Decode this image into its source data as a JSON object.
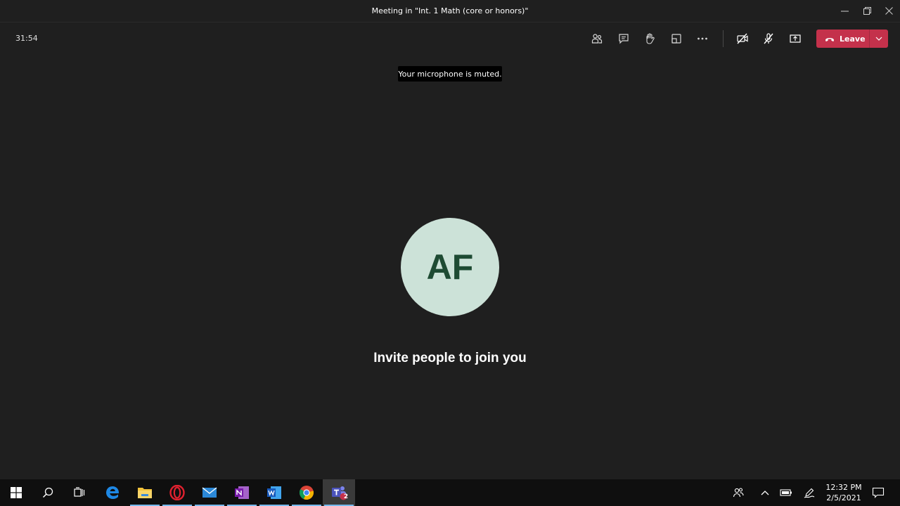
{
  "window": {
    "title": "Meeting in \"Int. 1 Math (core or honors)\"",
    "controls": [
      "minimize-icon",
      "restore-icon",
      "close-icon"
    ]
  },
  "meeting": {
    "timer": "31:54",
    "toolbar": [
      "participants-icon",
      "chat-icon",
      "raise-hand-icon",
      "breakout-rooms-icon",
      "more-options-icon",
      "camera-off-icon",
      "mic-off-icon",
      "share-screen-icon"
    ],
    "leave_label": "Leave",
    "accent": "#c4314b"
  },
  "toast": {
    "text": "Your microphone is muted."
  },
  "stage": {
    "avatar_initials": "AF",
    "avatar_bg": "#cce2d8",
    "avatar_fg": "#1e4b33",
    "invite_text": "Invite people to join you"
  },
  "taskbar": {
    "apps": [
      "windows-start-icon",
      "search-icon",
      "task-view-icon",
      "edge-icon",
      "file-explorer-icon",
      "opera-icon",
      "mail-icon",
      "onenote-icon",
      "word-icon",
      "chrome-icon",
      "teams-icon"
    ],
    "teams_badge": "2",
    "clock_time": "12:32 PM",
    "clock_date": "2/5/2021"
  }
}
